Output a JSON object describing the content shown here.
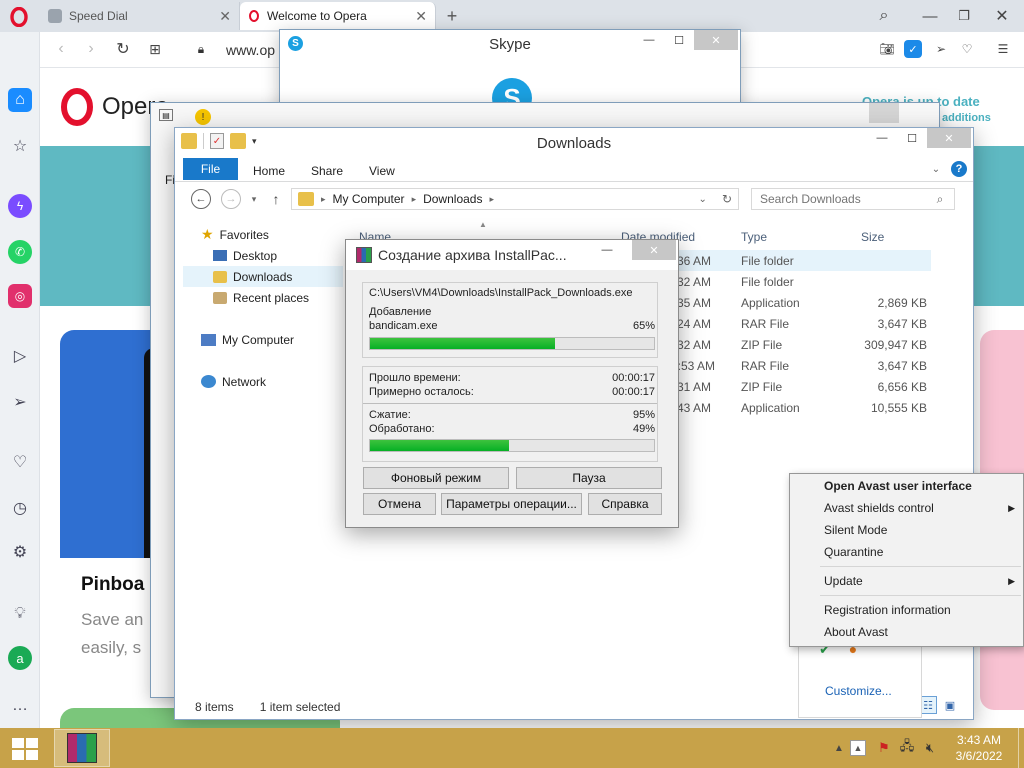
{
  "browser": {
    "tabs": [
      {
        "label": "Speed Dial",
        "active": false
      },
      {
        "label": "Welcome to Opera",
        "active": true
      }
    ],
    "address": "www.op",
    "page_logo": "Opera",
    "banner_partial": "Opera is up to date",
    "banner_sub_partial": "additions",
    "card_title": "Pinboa",
    "card_line1": "Save an",
    "card_line2": "easily, s"
  },
  "skype": {
    "title": "Skype"
  },
  "explorer": {
    "title": "Downloads",
    "ribbon_tabs": [
      "File",
      "Home",
      "Share",
      "View"
    ],
    "address_parts": [
      "My Computer",
      "Downloads"
    ],
    "search_placeholder": "Search Downloads",
    "tree": {
      "favorites": "Favorites",
      "desktop": "Desktop",
      "downloads": "Downloads",
      "recent": "Recent places",
      "computer": "My Computer",
      "network": "Network"
    },
    "columns": {
      "name": "Name",
      "date": "Date modified",
      "type": "Type",
      "size": "Size"
    },
    "rows": [
      {
        "date": "36 AM",
        "type": "File folder",
        "size": ""
      },
      {
        "date": "32 AM",
        "type": "File folder",
        "size": ""
      },
      {
        "date": "35 AM",
        "type": "Application",
        "size": "2,869 KB"
      },
      {
        "date": "24 AM",
        "type": "RAR File",
        "size": "3,647 KB"
      },
      {
        "date": "32 AM",
        "type": "ZIP File",
        "size": "309,947 KB"
      },
      {
        "date": "2:53 AM",
        "type": "RAR File",
        "size": "3,647 KB"
      },
      {
        "date": "31 AM",
        "type": "ZIP File",
        "size": "6,656 KB"
      },
      {
        "date": "43 AM",
        "type": "Application",
        "size": "10,555 KB"
      }
    ],
    "status_items": "8 items",
    "status_selected": "1 item selected",
    "behind_window_label": "Fi"
  },
  "rar": {
    "title": "Создание архива InstallPac...",
    "archive_path": "C:\\Users\\VM4\\Downloads\\InstallPack_Downloads.exe",
    "action": "Добавление",
    "current_file": "bandicam.exe",
    "file_percent_text": "65%",
    "file_progress": 65,
    "elapsed_label": "Прошло времени:",
    "elapsed": "00:00:17",
    "remaining_label": "Примерно осталось:",
    "remaining": "00:00:17",
    "compression_label": "Сжатие:",
    "compression": "95%",
    "processed_label": "Обработано:",
    "processed": "49%",
    "total_progress": 49,
    "btn_background": "Фоновый режим",
    "btn_pause": "Пауза",
    "btn_cancel": "Отмена",
    "btn_options": "Параметры операции...",
    "btn_help": "Справка"
  },
  "avast_menu": {
    "items": [
      {
        "label": "Open Avast user interface",
        "bold": true,
        "arrow": false
      },
      {
        "label": "Avast shields control",
        "bold": false,
        "arrow": true
      },
      {
        "label": "Silent Mode",
        "bold": false,
        "arrow": false
      },
      {
        "label": "Quarantine",
        "bold": false,
        "arrow": false
      },
      {
        "label": "Update",
        "bold": false,
        "arrow": true
      },
      {
        "label": "Registration information",
        "bold": false,
        "arrow": false
      },
      {
        "label": "About Avast",
        "bold": false,
        "arrow": false
      }
    ],
    "customize": "Customize..."
  },
  "taskbar": {
    "time": "3:43 AM",
    "date": "3/6/2022"
  },
  "colors": {
    "opera_red": "#e3102d",
    "skype_blue": "#1ba0e1",
    "progress_green": "#06b025",
    "taskbar": "#c7a249",
    "file_tab": "#1979ca"
  }
}
